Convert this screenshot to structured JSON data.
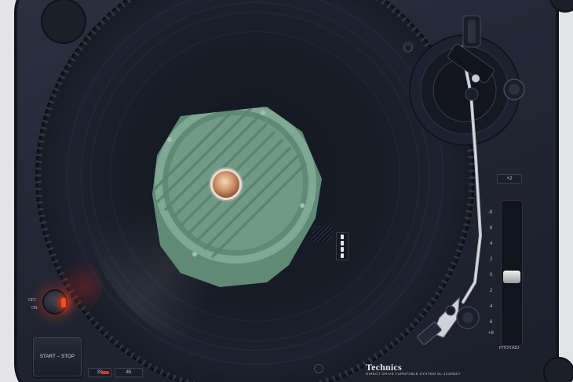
{
  "deck": {
    "brand": "Technics",
    "model_line": "DIRECT DRIVE TURNTABLE SYSTEM  SL-1210MK7",
    "start_stop_label": "START – STOP",
    "speed_33_label": "33",
    "speed_45_label": "45",
    "off_label": "OFF",
    "on_label": "ON",
    "x2_label": "×2",
    "pitch_adj_label": "PITCH ADJ",
    "pitch_scale": [
      "-8",
      "6",
      "4",
      "2",
      "0",
      "2",
      "4",
      "6",
      "+8"
    ],
    "pitch_value": 0,
    "colors": {
      "plinth": "#232836",
      "slipmat": "#6f9a85",
      "spindle": "#c98d63",
      "power_glow": "#ff3c14"
    }
  }
}
